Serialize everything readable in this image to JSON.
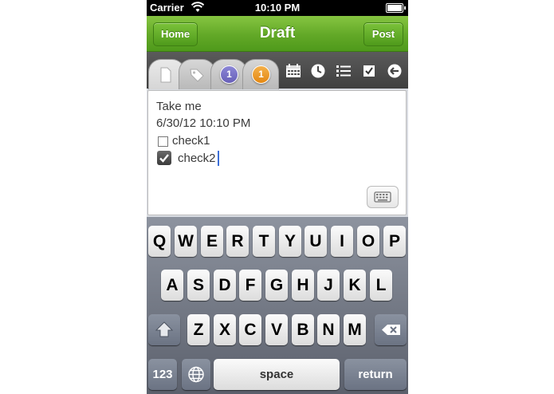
{
  "status_bar": {
    "carrier": "Carrier",
    "time": "10:10 PM"
  },
  "nav": {
    "title": "Draft",
    "home_label": "Home",
    "post_label": "Post",
    "accent": "#62a827"
  },
  "tabs": [
    {
      "name": "note-tab",
      "icon": "note-icon"
    },
    {
      "name": "tag-tab",
      "icon": "tag-icon"
    },
    {
      "name": "purple-count-tab",
      "badge": "1",
      "color": "#6860b8"
    },
    {
      "name": "orange-count-tab",
      "badge": "1",
      "color": "#e48812"
    }
  ],
  "toolbar_icons": [
    "calendar-icon",
    "clock-icon",
    "list-icon",
    "checkbox-icon",
    "back-arrow-icon"
  ],
  "editor": {
    "line1": "Take me",
    "line2": "6/30/12 10:10 PM",
    "check1": {
      "label": "check1",
      "checked": false
    },
    "check2": {
      "label": "check2",
      "checked": true
    }
  },
  "keyboard": {
    "row1": [
      "Q",
      "W",
      "E",
      "R",
      "T",
      "Y",
      "U",
      "I",
      "O",
      "P"
    ],
    "row2": [
      "A",
      "S",
      "D",
      "F",
      "G",
      "H",
      "J",
      "K",
      "L"
    ],
    "row3": [
      "Z",
      "X",
      "C",
      "V",
      "B",
      "N",
      "M"
    ],
    "numbers_label": "123",
    "space_label": "space",
    "return_label": "return"
  }
}
